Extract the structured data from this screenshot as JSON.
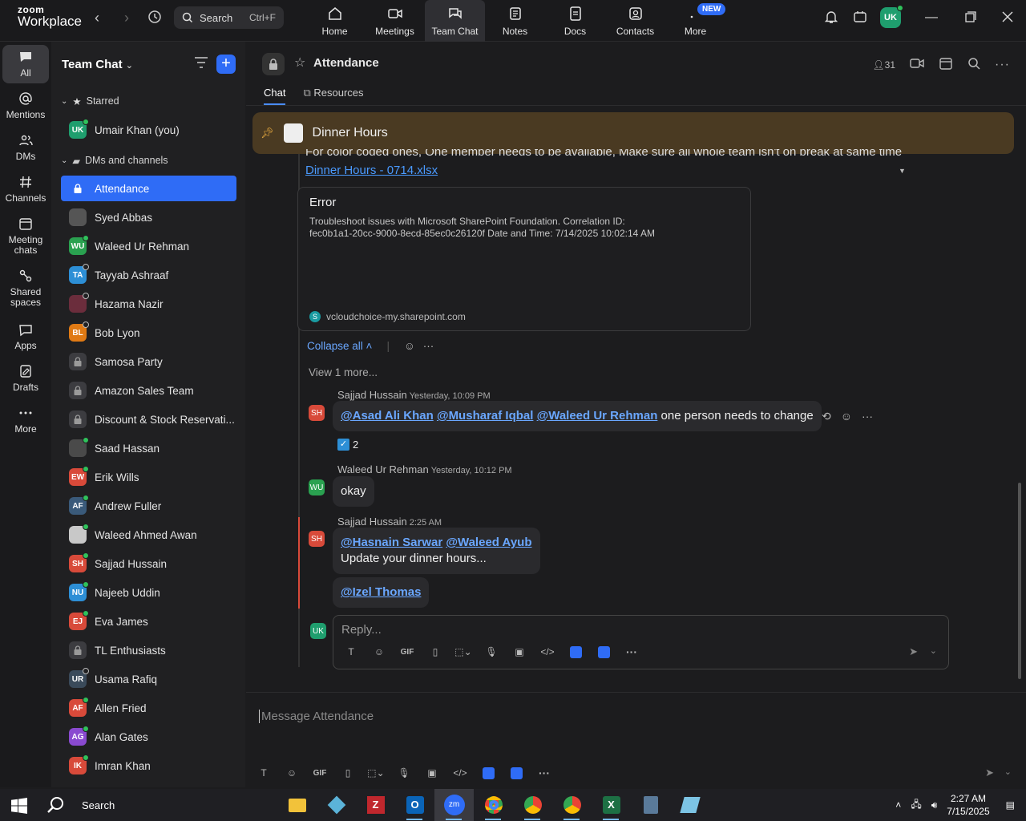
{
  "app": {
    "logo_line1": "zoom",
    "logo_line2": "Workplace"
  },
  "search": {
    "label": "Search",
    "shortcut": "Ctrl+F"
  },
  "topnav": {
    "tabs": [
      {
        "label": "Home",
        "icon": "home-icon"
      },
      {
        "label": "Meetings",
        "icon": "video-icon"
      },
      {
        "label": "Team Chat",
        "icon": "chat-icon",
        "active": true
      },
      {
        "label": "Notes",
        "icon": "notes-icon"
      },
      {
        "label": "Docs",
        "icon": "docs-icon"
      },
      {
        "label": "Contacts",
        "icon": "contacts-icon"
      },
      {
        "label": "More",
        "icon": "more-icon",
        "badge": "NEW"
      }
    ],
    "user_initials": "UK"
  },
  "rail": {
    "items": [
      {
        "label": "All",
        "icon": "chat-bubble-icon",
        "active": true
      },
      {
        "label": "Mentions",
        "icon": "at-icon"
      },
      {
        "label": "DMs",
        "icon": "people-icon"
      },
      {
        "label": "Channels",
        "icon": "hash-icon"
      },
      {
        "label": "Meeting chats",
        "icon": "calendar-icon"
      },
      {
        "label": "Shared spaces",
        "icon": "shared-icon"
      },
      {
        "label": "Apps",
        "icon": "apps-icon"
      },
      {
        "label": "Drafts",
        "icon": "drafts-icon"
      },
      {
        "label": "More",
        "icon": "ellipsis-icon"
      }
    ]
  },
  "sidebar": {
    "title": "Team Chat",
    "starred_label": "Starred",
    "starred_item": {
      "initials": "UK",
      "name": "Umair Khan (you)",
      "color": "#1f9e6e"
    },
    "dms_label": "DMs and channels",
    "items": [
      {
        "name": "Attendance",
        "kind": "lock",
        "active": true
      },
      {
        "name": "Syed Abbas",
        "kind": "photo",
        "color": "#555"
      },
      {
        "name": "Waleed Ur Rehman",
        "initials": "WU",
        "color": "#2aa150",
        "status": "online"
      },
      {
        "name": "Tayyab Ashraaf",
        "initials": "TA",
        "color": "#2d8fd6",
        "status": "away"
      },
      {
        "name": "Hazama Nazir",
        "kind": "photo",
        "color": "#6b2d3c",
        "status": "away"
      },
      {
        "name": "Bob Lyon",
        "initials": "BL",
        "color": "#e07a14",
        "status": "away"
      },
      {
        "name": "Samosa Party",
        "kind": "lock"
      },
      {
        "name": "Amazon Sales Team",
        "kind": "lock"
      },
      {
        "name": "Discount & Stock Reservati...",
        "kind": "lock"
      },
      {
        "name": "Saad Hassan",
        "kind": "photo",
        "color": "#4a4a4a",
        "status": "online"
      },
      {
        "name": "Erik Wills",
        "initials": "EW",
        "color": "#d84a3a",
        "status": "online"
      },
      {
        "name": "Andrew Fuller",
        "initials": "AF",
        "color": "#3a5a7a",
        "status": "online"
      },
      {
        "name": "Waleed Ahmed Awan",
        "kind": "photo",
        "color": "#c8c8c8",
        "status": "online"
      },
      {
        "name": "Sajjad Hussain",
        "initials": "SH",
        "color": "#d84a3a",
        "status": "online"
      },
      {
        "name": "Najeeb Uddin",
        "initials": "NU",
        "color": "#2d8fd6",
        "status": "online"
      },
      {
        "name": "Eva James",
        "initials": "EJ",
        "color": "#d84a3a",
        "status": "online"
      },
      {
        "name": "TL Enthusiasts",
        "kind": "lock"
      },
      {
        "name": "Usama Rafiq",
        "initials": "UR",
        "color": "#3a4a5a",
        "status": "away"
      },
      {
        "name": "Allen Fried",
        "initials": "AF",
        "color": "#d84a3a",
        "status": "online"
      },
      {
        "name": "Alan Gates",
        "initials": "AG",
        "color": "#8a4ad0",
        "status": "online"
      },
      {
        "name": "Imran Khan",
        "initials": "IK",
        "color": "#d84a3a",
        "status": "online"
      }
    ]
  },
  "channel": {
    "title": "Attendance",
    "members": "31",
    "tabs": [
      "Chat",
      "Resources"
    ],
    "pinned": "Dinner Hours",
    "cut_text": "For color coded ones, One member needs to be available, Make sure all whole team isn't on break at same time",
    "file_link": "Dinner Hours - 0714.xlsx",
    "card": {
      "title": "Error",
      "body": "Troubleshoot issues with Microsoft SharePoint Foundation. Correlation ID: fec0b1a1-20cc-9000-8ecd-85ec0c26120f Date and Time: 7/14/2025 10:02:14 AM",
      "source": "vcloudchoice-my.sharepoint.com"
    },
    "collapse_all": "Collapse all",
    "view_more": "View 1 more...",
    "messages": [
      {
        "initials": "SH",
        "color": "#d84a3a",
        "author": "Sajjad Hussain",
        "time": "Yesterday, 10:09 PM",
        "mentions": [
          "@Asad Ali Khan",
          "@Musharaf Iqbal",
          "@Waleed Ur Rehman"
        ],
        "text": "one person needs to change",
        "reaction_count": "2"
      },
      {
        "initials": "WU",
        "color": "#2aa150",
        "author": "Waleed Ur Rehman",
        "time": "Yesterday, 10:12 PM",
        "text": "okay"
      },
      {
        "initials": "SH",
        "color": "#d84a3a",
        "author": "Sajjad Hussain",
        "time": "2:25 AM",
        "mentions": [
          "@Hasnain Sarwar",
          "@Waleed Ayub"
        ],
        "text": "Update your dinner hours...",
        "followup_mention": "@Izel Thomas"
      }
    ],
    "reply_placeholder": "Reply...",
    "reply_initials": "UK",
    "compose_placeholder": "Message Attendance",
    "toolbar_gif": "GIF"
  },
  "taskbar": {
    "search": "Search",
    "time": "2:27 AM",
    "date": "7/15/2025"
  },
  "colors": {
    "accent": "#2f6cf6",
    "mention": "#6aa7ff",
    "pinned_bg": "#4a3a22"
  }
}
